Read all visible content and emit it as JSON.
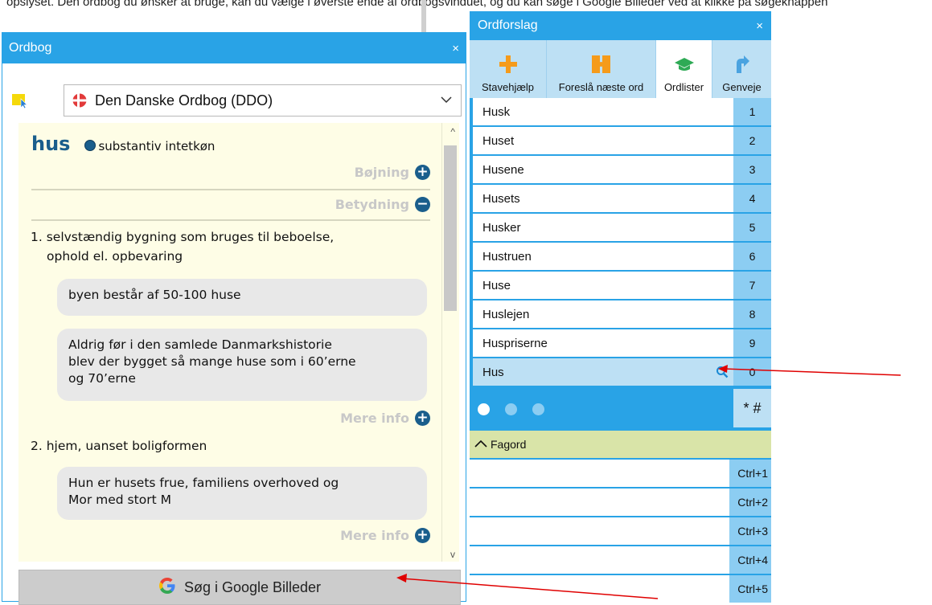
{
  "top_text": "opslyset. Den ordbog du ønsker at bruge, kan du vælge i øverste ende af ordbogsvinduet, og du kan søge i Google Billeder ved at klikke på søgeknappen",
  "ordbog": {
    "title": "Ordbog",
    "close": "×",
    "dictionary": "Den Danske Ordbog (DDO)",
    "headword": "hus",
    "pos": "substantiv intetkøn",
    "boejning": "Bøjning",
    "betydning": "Betydning",
    "sense1_line1": "1. selvstændig bygning som bruges til beboelse,",
    "sense1_line2": "ophold el. opbevaring",
    "example1": "byen består af 50-100 huse",
    "example2_line1": "Aldrig før i den samlede Danmarkshistorie",
    "example2_line2": "blev der bygget så mange huse som i 60’erne",
    "example2_line3": "og 70’erne",
    "mere_info": "Mere info",
    "sense2": "2. hjem, uanset boligformen",
    "example3_line1": "Hun er husets frue, familiens overhoved og",
    "example3_line2": "Mor med stort M",
    "google_button": "Søg i Google Billeder"
  },
  "ordforslag": {
    "title": "Ordforslag",
    "close": "×",
    "tools": [
      "Stavehjælp",
      "Foreslå næste ord",
      "Ordlister",
      "Genveje"
    ],
    "suggestions": [
      {
        "word": "Husk",
        "num": "1"
      },
      {
        "word": "Huset",
        "num": "2"
      },
      {
        "word": "Husene",
        "num": "3"
      },
      {
        "word": "Husets",
        "num": "4"
      },
      {
        "word": "Husker",
        "num": "5"
      },
      {
        "word": "Hustruen",
        "num": "6"
      },
      {
        "word": "Huse",
        "num": "7"
      },
      {
        "word": "Huslejen",
        "num": "8"
      },
      {
        "word": "Huspriserne",
        "num": "9"
      },
      {
        "word": "Hus",
        "num": "0"
      }
    ],
    "symbols": "* #",
    "fagord": "Fagord",
    "shortcuts": [
      "Ctrl+1",
      "Ctrl+2",
      "Ctrl+3",
      "Ctrl+4",
      "Ctrl+5"
    ]
  },
  "colors": {
    "accent": "#29a3e6",
    "light_blue": "#bde0f4",
    "num_blue": "#8ccdf2",
    "dict_bg": "#fefde6",
    "headword": "#1a5e8c",
    "arrow": "#e00000",
    "fagord_bg": "#d9e4a8"
  }
}
